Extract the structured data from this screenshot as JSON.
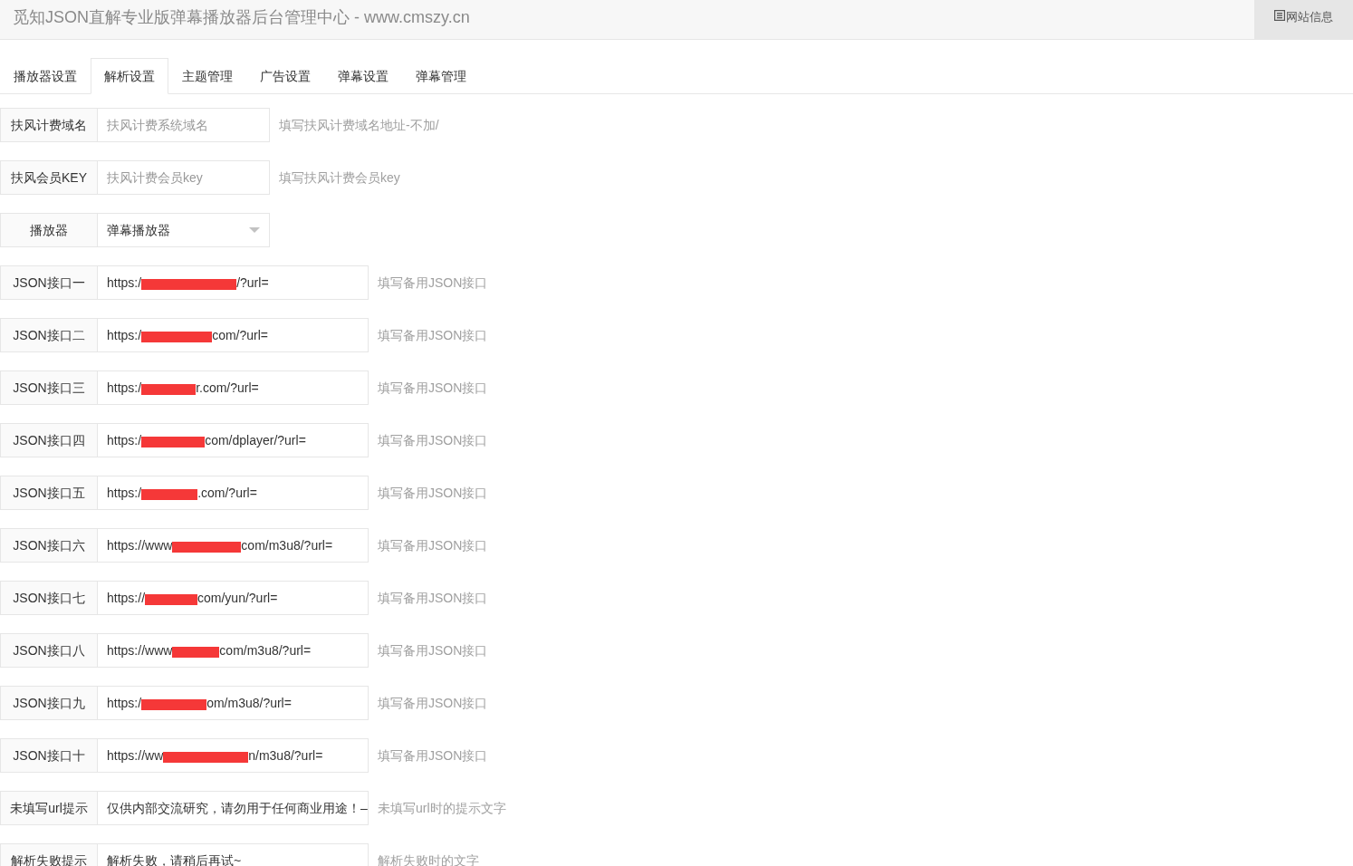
{
  "header": {
    "title": "觅知JSON直解专业版弹幕播放器后台管理中心 - www.cmszy.cn",
    "site_info_button": "网站信息"
  },
  "tabs": [
    {
      "label": "播放器设置",
      "selected": false
    },
    {
      "label": "解析设置",
      "selected": true
    },
    {
      "label": "主题管理",
      "selected": false
    },
    {
      "label": "广告设置",
      "selected": false
    },
    {
      "label": "弹幕设置",
      "selected": false
    },
    {
      "label": "弹幕管理",
      "selected": false
    }
  ],
  "fields": [
    {
      "label": "扶风计费域名",
      "kind": "text",
      "wide": false,
      "placeholder": "扶风计费系统域名",
      "hint": "填写扶风计费域名地址-不加/"
    },
    {
      "label": "扶风会员KEY",
      "kind": "text",
      "wide": false,
      "placeholder": "扶风计费会员key",
      "hint": "填写扶风计费会员key"
    },
    {
      "label": "播放器",
      "kind": "select",
      "wide": false,
      "value": "弹幕播放器"
    },
    {
      "label": "JSON接口一",
      "kind": "redacted",
      "wide": true,
      "value_before": "https:/",
      "value_after": "/?url=",
      "hint": "填写备用JSON接口"
    },
    {
      "label": "JSON接口二",
      "kind": "redacted",
      "wide": true,
      "value_before": "https:/",
      "value_after": "com/?url=",
      "hint": "填写备用JSON接口"
    },
    {
      "label": "JSON接口三",
      "kind": "redacted",
      "wide": true,
      "value_before": "https:/",
      "value_after": "r.com/?url=",
      "hint": "填写备用JSON接口"
    },
    {
      "label": "JSON接口四",
      "kind": "redacted",
      "wide": true,
      "value_before": "https:/",
      "value_after": "com/dplayer/?url=",
      "hint": "填写备用JSON接口"
    },
    {
      "label": "JSON接口五",
      "kind": "redacted",
      "wide": true,
      "value_before": "https:/",
      "value_after": ".com/?url=",
      "hint": "填写备用JSON接口"
    },
    {
      "label": "JSON接口六",
      "kind": "redacted",
      "wide": true,
      "value_before": "https://www",
      "value_after": "com/m3u8/?url=",
      "hint": "填写备用JSON接口"
    },
    {
      "label": "JSON接口七",
      "kind": "redacted",
      "wide": true,
      "value_before": "https://",
      "value_after": "com/yun/?url=",
      "hint": "填写备用JSON接口"
    },
    {
      "label": "JSON接口八",
      "kind": "redacted",
      "wide": true,
      "value_before": "https://www",
      "value_after": "com/m3u8/?url=",
      "hint": "填写备用JSON接口"
    },
    {
      "label": "JSON接口九",
      "kind": "redacted",
      "wide": true,
      "value_before": "https:/",
      "value_after": "om/m3u8/?url=",
      "hint": "填写备用JSON接口"
    },
    {
      "label": "JSON接口十",
      "kind": "redacted",
      "wide": true,
      "value_before": "https://ww",
      "value_after": "n/m3u8/?url=",
      "hint": "填写备用JSON接口"
    },
    {
      "label": "未填写url提示",
      "kind": "text",
      "wide": true,
      "value": "仅供内部交流研究，请勿用于任何商业用途！–",
      "hint": "未填写url时的提示文字"
    },
    {
      "label": "解析失败提示",
      "kind": "text",
      "wide": true,
      "value": "解析失败，请稍后再试~",
      "hint": "解析失败时的文字"
    }
  ]
}
